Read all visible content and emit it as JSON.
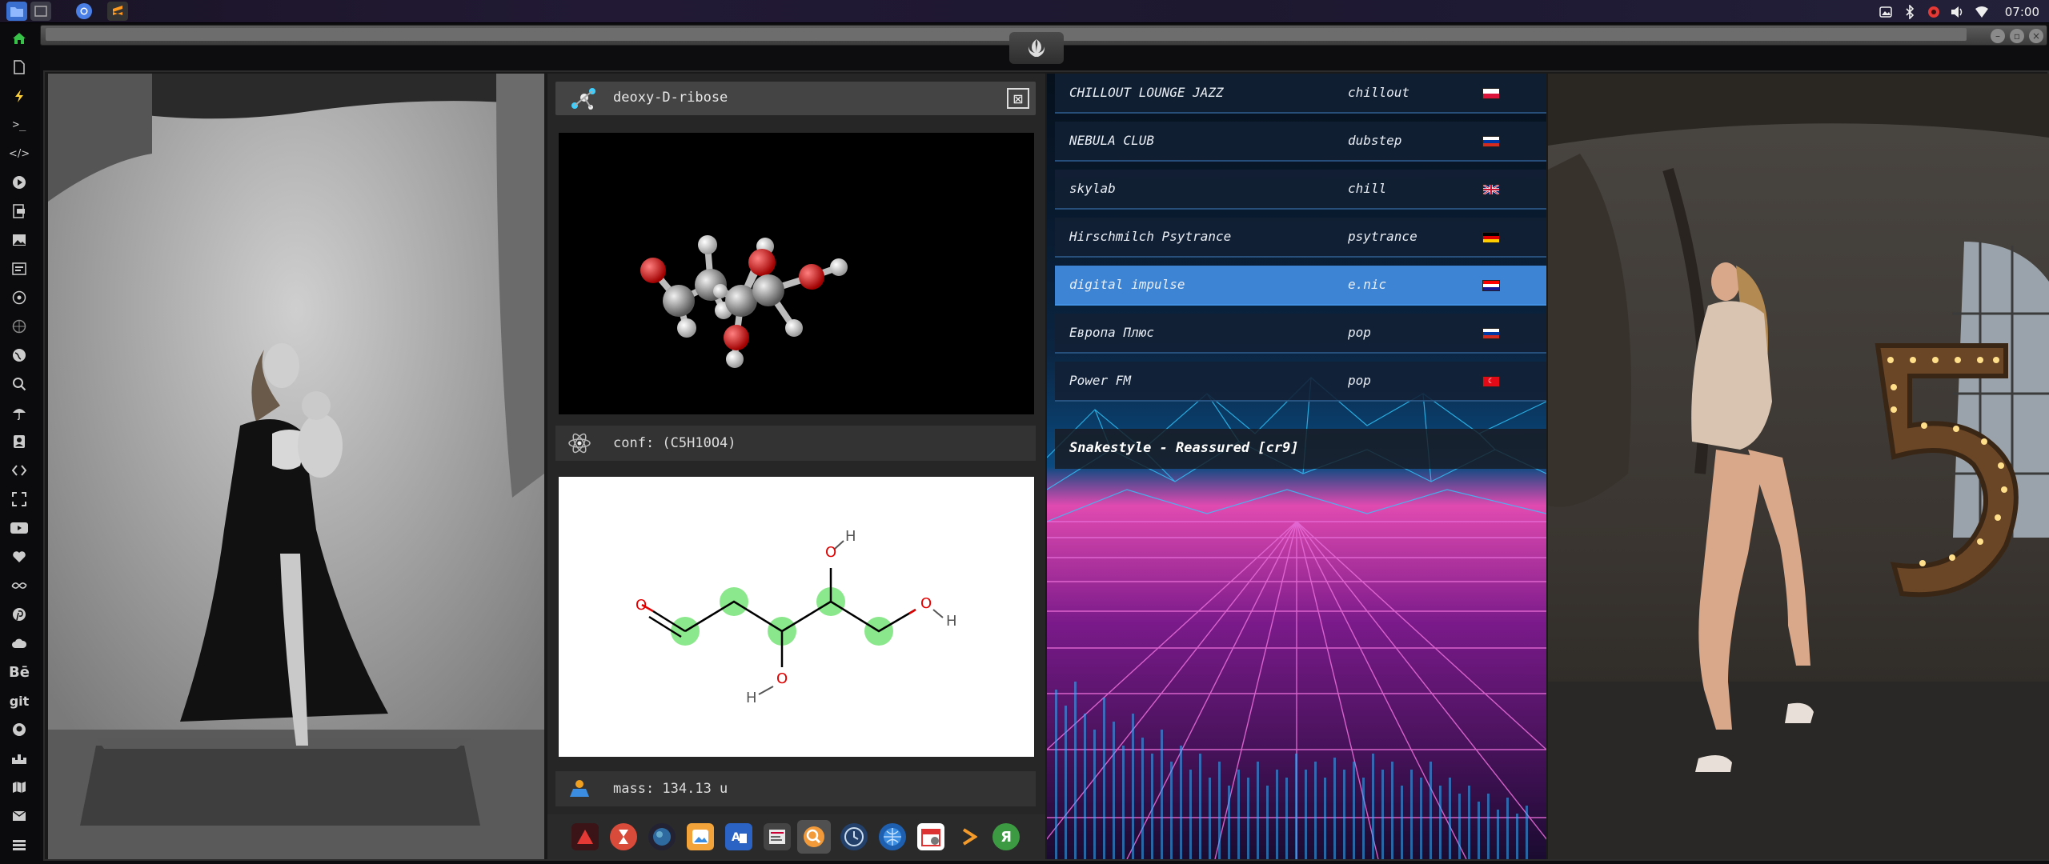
{
  "topbar": {
    "clock": "07:00",
    "launchers": [
      "files-icon",
      "window-icon",
      "chromium-icon",
      "sublime-icon"
    ],
    "tray": [
      "screenshot-icon",
      "bluetooth-icon",
      "settings-icon",
      "volume-icon",
      "wifi-icon"
    ]
  },
  "left_dock": {
    "items": [
      "home-icon",
      "document-icon",
      "lightning-icon",
      "terminal-icon",
      "code-icon",
      "play-icon",
      "pdf-icon",
      "image-icon",
      "slides-icon",
      "atom-icon",
      "web-icon",
      "globe-icon",
      "search-icon",
      "umbrella-icon",
      "contacts-icon",
      "dev-icon",
      "fullscreen-icon",
      "youtube-icon",
      "heart-icon",
      "infinity-icon",
      "pinterest-icon",
      "cloud-icon"
    ],
    "text_items": [
      "Bē",
      "git"
    ],
    "bottom_items": [
      "github-icon",
      "fortress-icon",
      "map-icon",
      "mail-icon",
      "list-icon"
    ]
  },
  "molecule": {
    "name": "deoxy-D-ribose",
    "conf_label": "conf: (C5H10O4)",
    "mass_label": "mass: 134.13 u"
  },
  "app_dock": {
    "items": [
      "triangle-app",
      "hourglass-app",
      "planet-app",
      "photos-app",
      "translate-app",
      "text-editor-app",
      "search-app",
      "clock-app",
      "browser-app",
      "calendar-app",
      "prompt-app",
      "yandex-app"
    ],
    "yandex_letter": "Я"
  },
  "radio": {
    "stations": [
      {
        "name": "CHILLOUT LOUNGE JAZZ",
        "genre": "chillout",
        "flag": "pl"
      },
      {
        "name": "NEBULA CLUB",
        "genre": "dubstep",
        "flag": "ru"
      },
      {
        "name": "skylab",
        "genre": "chill",
        "flag": "gb"
      },
      {
        "name": "Hirschmilch Psytrance",
        "genre": "psytrance",
        "flag": "de"
      },
      {
        "name": "digital impulse",
        "genre": "e.nic",
        "flag": "hr"
      },
      {
        "name": "Европа Плюс",
        "genre": "pop",
        "flag": "ru"
      },
      {
        "name": "Power FM",
        "genre": "pop",
        "flag": "tr"
      }
    ],
    "selected_index": 4,
    "now_playing": "Snakestyle - Reassured [cr9]"
  },
  "chart_atoms": {
    "O": "O",
    "H": "H"
  }
}
